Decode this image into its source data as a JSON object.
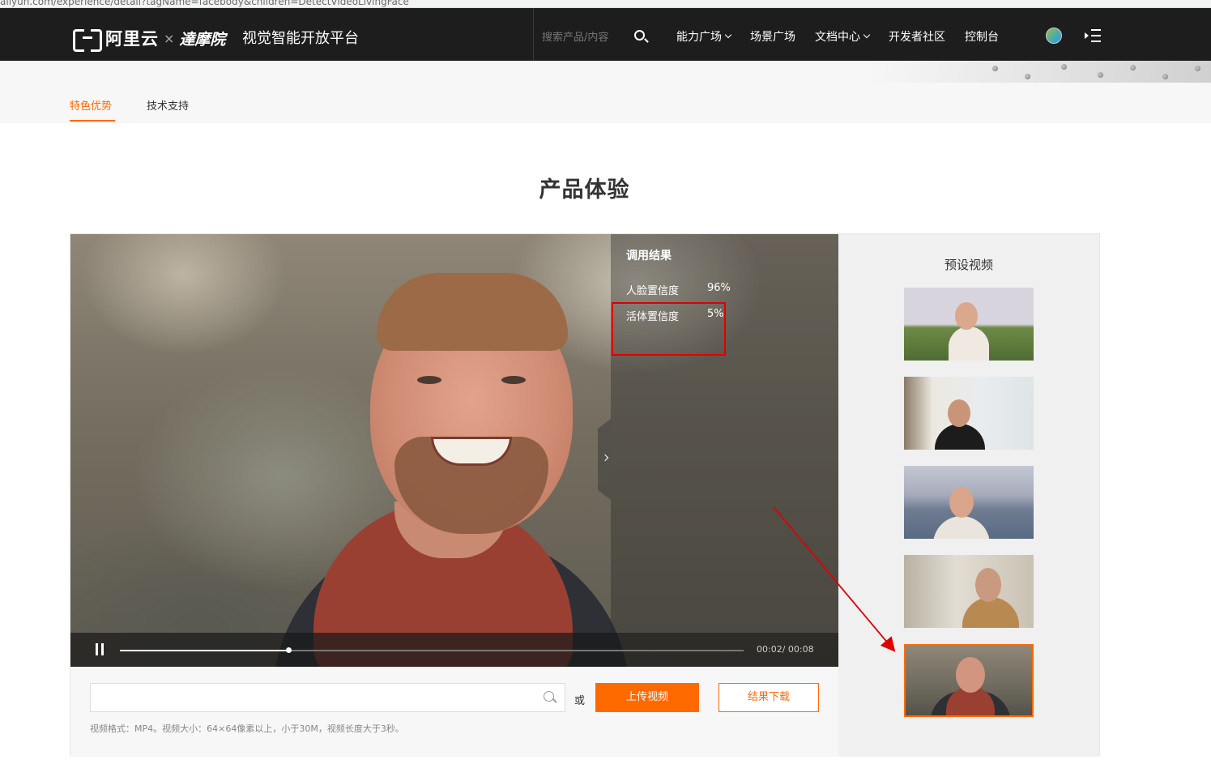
{
  "browser": {
    "url": "aliyun.com/experience/detail?tagName=facebody&children=DetectVideoLivingFace"
  },
  "header": {
    "logo_text": "阿里云",
    "logo_x": "×",
    "logo_damo": "達摩院",
    "platform": "视觉智能开放平台",
    "search_placeholder": "搜索产品/内容",
    "menu": [
      {
        "label": "能力广场",
        "dropdown": true
      },
      {
        "label": "场景广场",
        "dropdown": false
      },
      {
        "label": "文档中心",
        "dropdown": true
      },
      {
        "label": "开发者社区",
        "dropdown": false
      },
      {
        "label": "控制台",
        "dropdown": false
      }
    ]
  },
  "subnav": {
    "tabs": [
      {
        "label": "特色优势",
        "active": true
      },
      {
        "label": "技术支持",
        "active": false
      }
    ]
  },
  "section": {
    "title": "产品体验"
  },
  "results": {
    "title": "调用结果",
    "rows": [
      {
        "label": "人脸置信度",
        "value": "96%"
      },
      {
        "label": "活体置信度",
        "value": "5%"
      }
    ]
  },
  "player": {
    "current_time": "00:02/",
    "duration": "00:08",
    "progress": 0.27
  },
  "upload": {
    "input_value": "",
    "or_text": "或",
    "upload_label": "上传视频",
    "download_label": "结果下载",
    "hint": "视频格式：MP4。视频大小：64×64像素以上，小于30M，视频长度大于3秒。"
  },
  "preset": {
    "title": "预设视频",
    "selected_index": 4,
    "count": 5
  },
  "colors": {
    "accent": "#ff6a00",
    "nav_bg": "#1d1d1d",
    "annotation_red": "#e00000"
  }
}
